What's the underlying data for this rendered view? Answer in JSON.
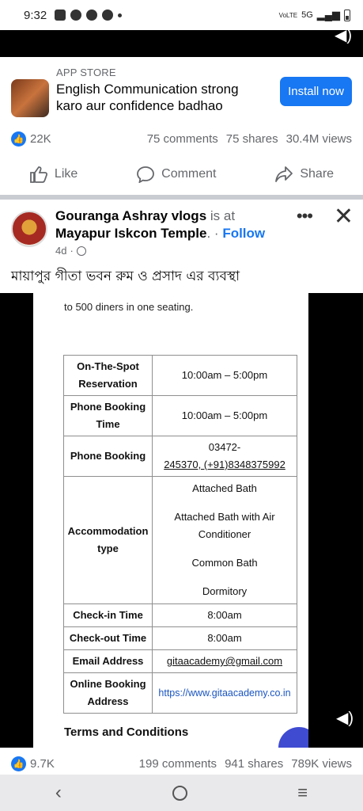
{
  "status_bar": {
    "time": "9:32",
    "network": "5G",
    "volte": "VoLTE"
  },
  "ad": {
    "store_label": "APP STORE",
    "title": "English Communication strong karo aur confidence badhao",
    "install_label": "Install now"
  },
  "ad_stats": {
    "likes": "22K",
    "comments": "75 comments",
    "shares": "75 shares",
    "views": "30.4M views"
  },
  "actions": {
    "like": "Like",
    "comment": "Comment",
    "share": "Share"
  },
  "post": {
    "author": "Gouranga Ashray vlogs",
    "is_at": "is at",
    "location": "Mayapur Iskcon Temple",
    "follow": "Follow",
    "time": "4d",
    "caption": "মায়াপুর গীতা ভবন রুম ও প্রসাদ এর ব্যবস্থা"
  },
  "document": {
    "intro": "to 500 diners in one seating.",
    "rows": [
      {
        "key": "On-The-Spot Reservation",
        "value": "10:00am – 5:00pm"
      },
      {
        "key": "Phone Booking Time",
        "value": "10:00am – 5:00pm"
      },
      {
        "key": "Phone Booking",
        "value_line1": "03472-",
        "value_line2": "245370, (+91)8348375992"
      },
      {
        "key": "Accommodation type",
        "options": [
          "Attached Bath",
          "Attached Bath with Air Conditioner",
          "Common Bath",
          "Dormitory"
        ]
      },
      {
        "key": "Check-in Time",
        "value": "8:00am"
      },
      {
        "key": "Check-out Time",
        "value": "8:00am"
      },
      {
        "key": "Email Address",
        "value": "gitaacademy@gmail.com"
      },
      {
        "key": "Online Booking Address",
        "value": "https://www.gitaacademy.co.in"
      }
    ],
    "terms_heading": "Terms and Conditions"
  },
  "post_stats": {
    "likes": "9.7K",
    "comments": "199 comments",
    "shares": "941 shares",
    "views": "789K views"
  },
  "colors": {
    "brand": "#1877f2",
    "text": "#050505",
    "muted": "#65676b"
  }
}
